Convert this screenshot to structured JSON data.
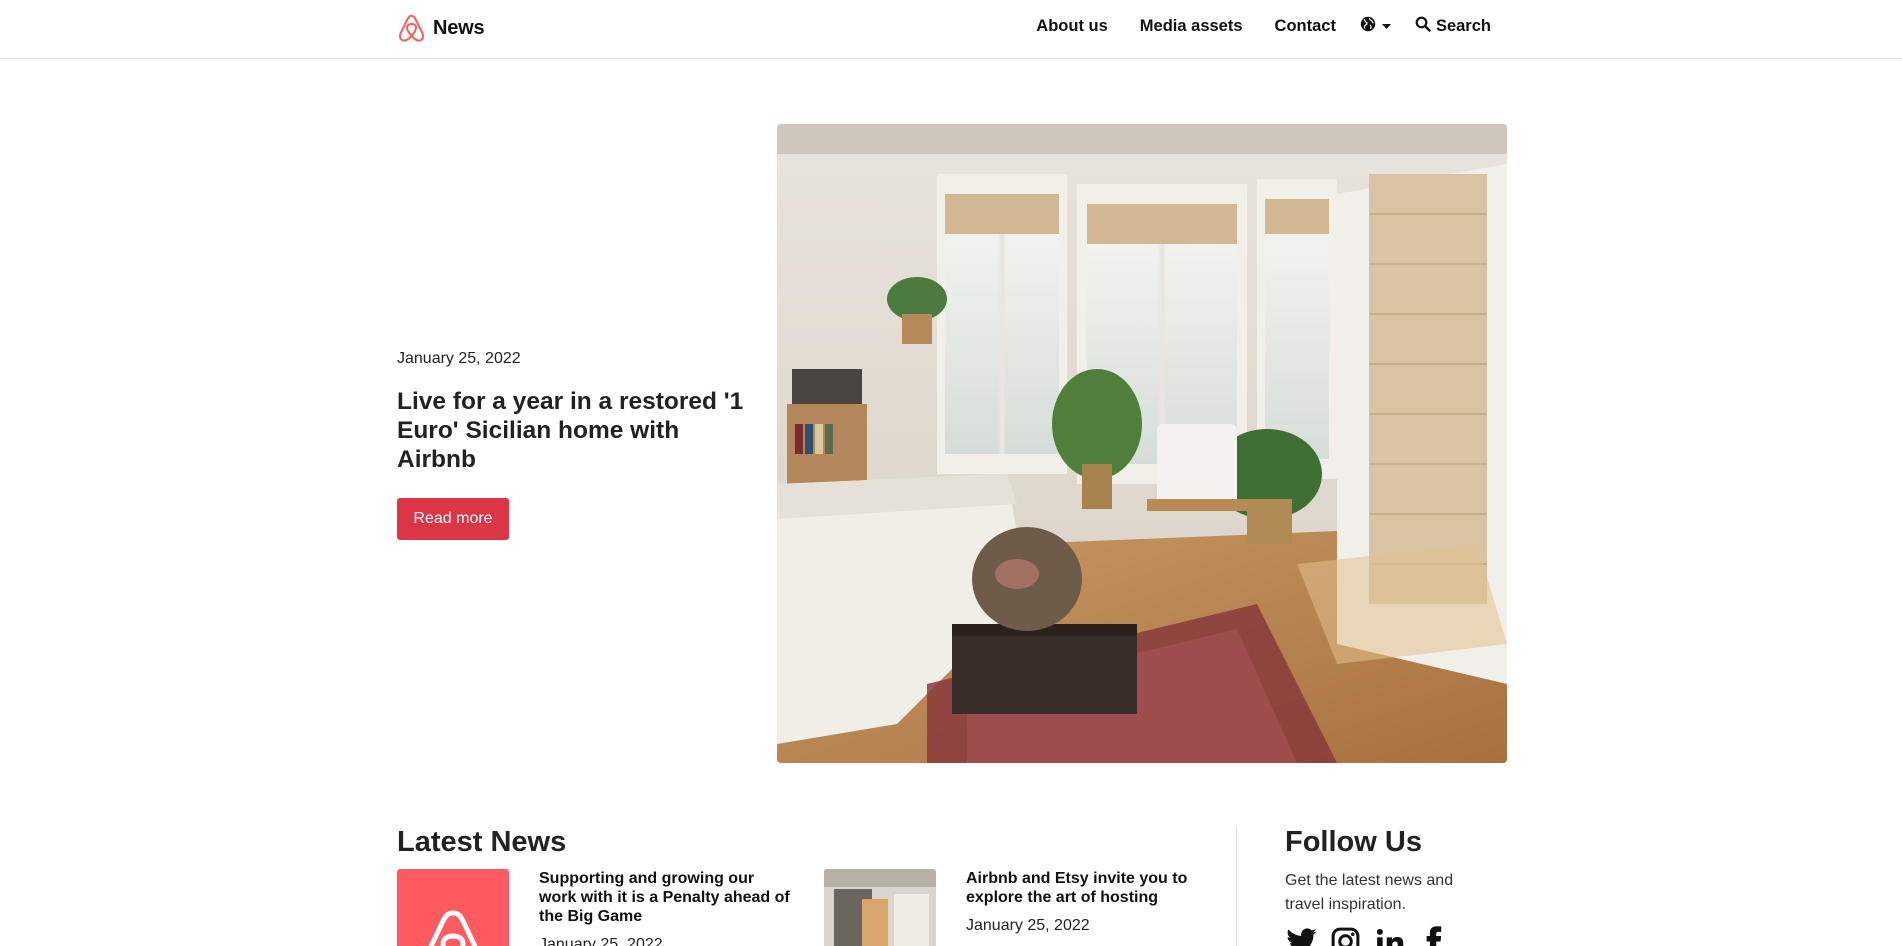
{
  "header": {
    "brand": "News",
    "nav": [
      {
        "label": "About us"
      },
      {
        "label": "Media assets"
      },
      {
        "label": "Contact"
      }
    ],
    "language_icon": "globe-icon",
    "search_label": "Search"
  },
  "hero": {
    "date": "January 25, 2022",
    "title": "Live for a year in a restored '1 Euro' Sicilian home with Airbnb",
    "cta": "Read more",
    "image": "sunlit bedroom with plants, armchair and globe"
  },
  "latest": {
    "heading": "Latest News",
    "items": [
      {
        "title": "Supporting and growing our work with it is a Penalty ahead of the Big Game",
        "date": "January 25, 2022",
        "thumb": "airbnb-logo-thumbnail"
      },
      {
        "title": "Airbnb and Etsy invite you to explore the art of hosting",
        "date": "January 25, 2022",
        "thumb": "interior-photo-thumbnail"
      }
    ]
  },
  "follow": {
    "heading": "Follow Us",
    "text": "Get the latest news and travel inspiration.",
    "icons": [
      "twitter-icon",
      "instagram-icon",
      "linkedin-icon",
      "facebook-icon"
    ]
  },
  "colors": {
    "brand": "#ff5a5f",
    "cta": "#dc3545",
    "text": "#222222"
  }
}
